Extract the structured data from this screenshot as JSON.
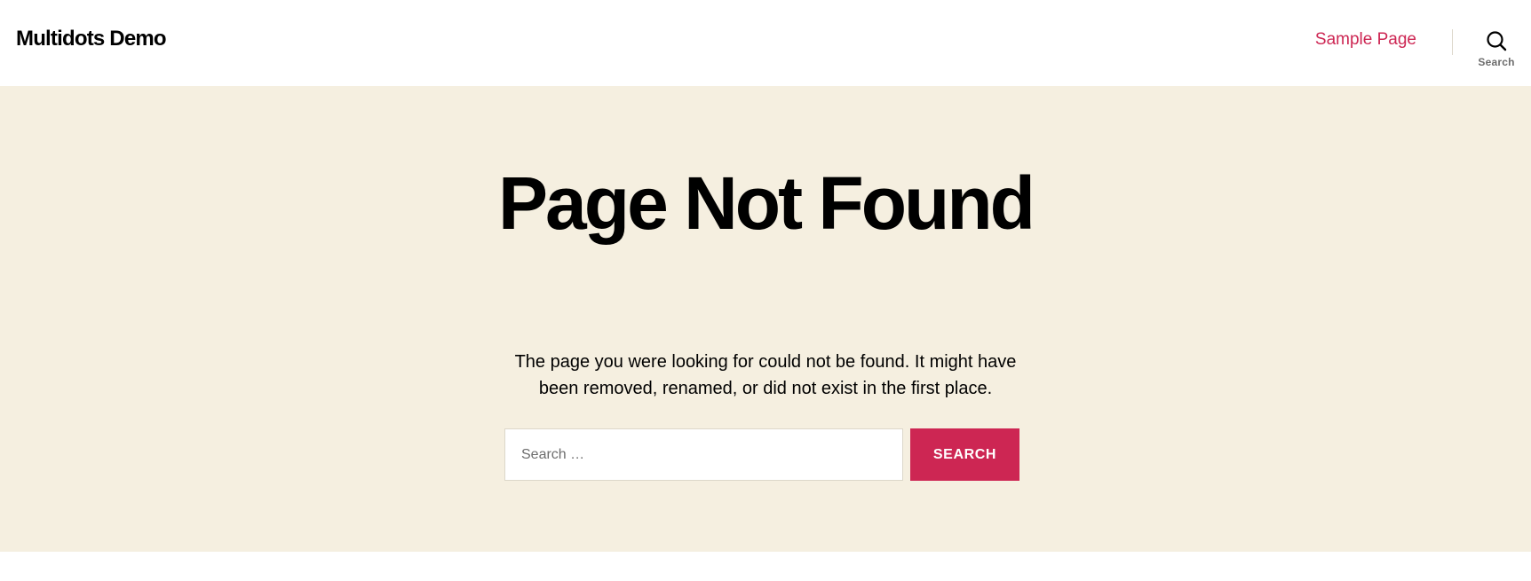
{
  "header": {
    "site_title": "Multidots Demo",
    "nav_link": "Sample Page",
    "search_toggle_label": "Search",
    "search_icon": "search-icon"
  },
  "main": {
    "title": "Page Not Found",
    "intro": "The page you were looking for could not be found. It might have been removed, renamed, or did not exist in the first place.",
    "search": {
      "placeholder": "Search …",
      "value": "",
      "button_label": "SEARCH"
    }
  },
  "colors": {
    "accent": "#cd2653",
    "hero_background": "#f5efe0",
    "header_background": "#ffffff",
    "text": "#000000",
    "muted_text": "#6d6d6d",
    "border": "#dcd7ca"
  }
}
